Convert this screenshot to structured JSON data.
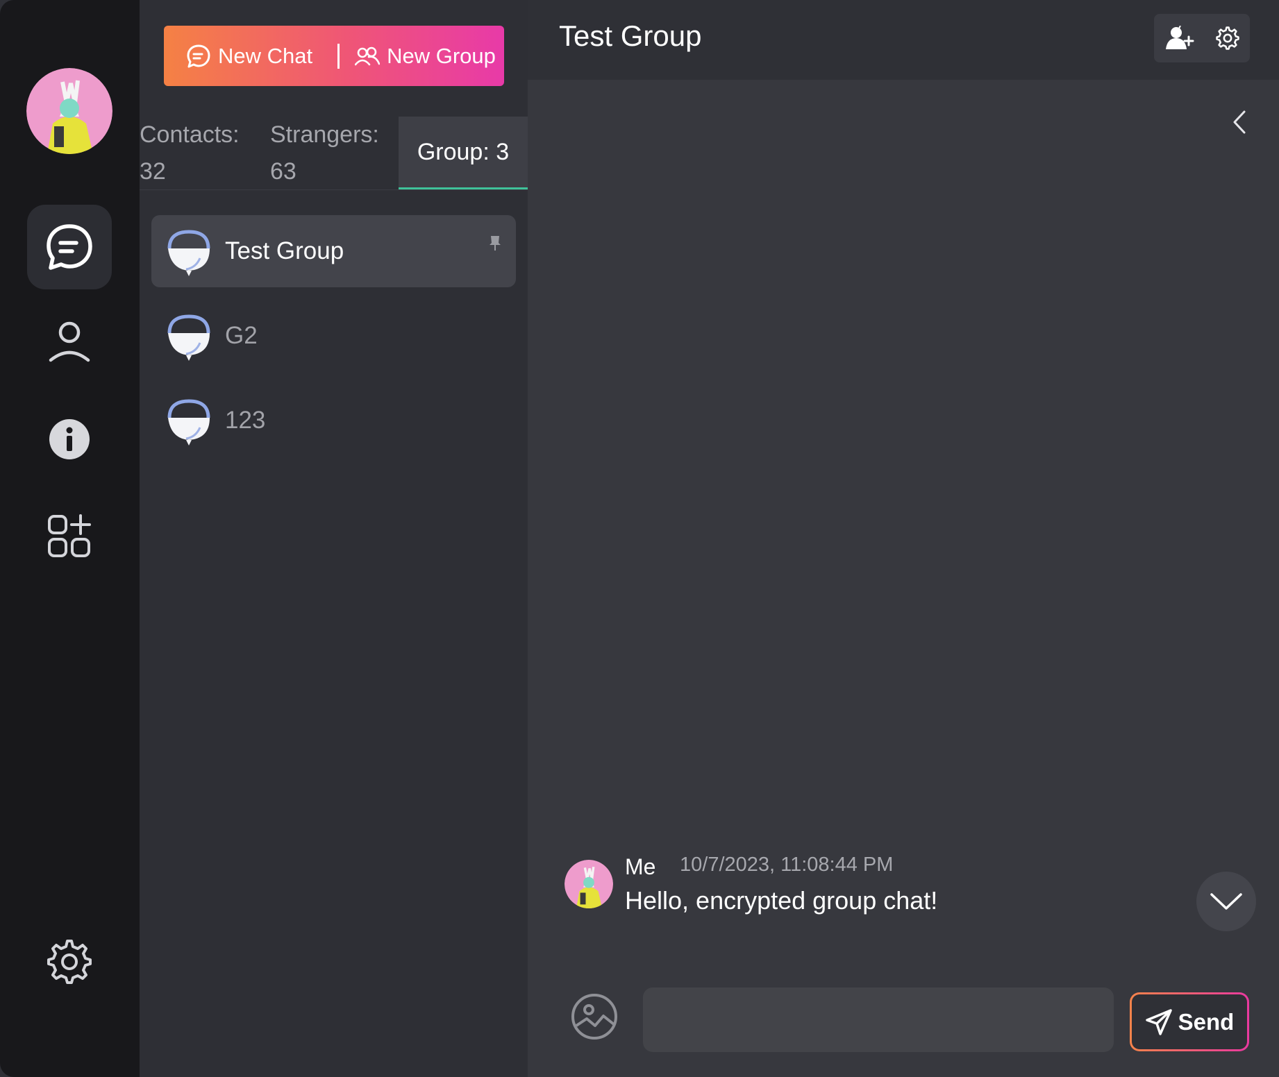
{
  "sidebar": {
    "avatar": "user-avatar",
    "items": [
      {
        "icon": "chat-bubble-icon",
        "active": true
      },
      {
        "icon": "user-icon",
        "active": false
      },
      {
        "icon": "info-icon",
        "active": false
      },
      {
        "icon": "apps-add-icon",
        "active": false
      }
    ],
    "settings_icon": "gear-icon"
  },
  "list": {
    "new_chat_label": "New Chat",
    "new_group_label": "New Group",
    "tabs": [
      {
        "label": "Contacts:",
        "count": "32"
      },
      {
        "label": "Strangers:",
        "count": "63"
      },
      {
        "label": "Group: 3"
      }
    ],
    "groups": [
      {
        "name": "Test Group",
        "active": true,
        "pinned": true
      },
      {
        "name": "G2",
        "active": false
      },
      {
        "name": "123",
        "active": false
      }
    ]
  },
  "chat": {
    "title": "Test Group",
    "messages": [
      {
        "sender": "Me",
        "time": "10/7/2023, 11:08:44 PM",
        "text": "Hello, encrypted group chat!"
      }
    ],
    "input_value": "",
    "send_label": "Send"
  },
  "colors": {
    "accent_start": "#f58144",
    "accent_end": "#e83aa8",
    "tab_underline": "#3fc29a"
  }
}
